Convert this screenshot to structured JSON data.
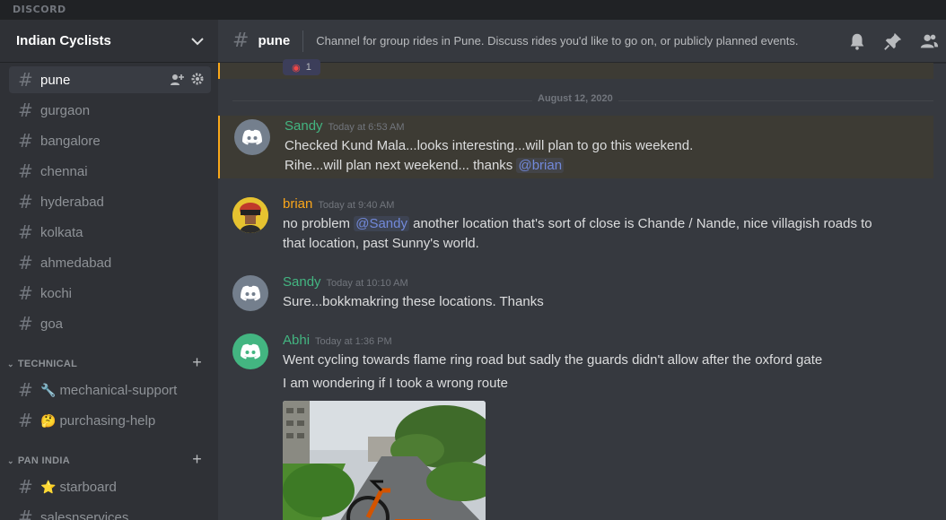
{
  "app": {
    "brand": "DISCORD"
  },
  "server": {
    "name": "Indian Cyclists"
  },
  "channels": [
    {
      "name": "pune",
      "active": true
    },
    {
      "name": "gurgaon"
    },
    {
      "name": "bangalore"
    },
    {
      "name": "chennai"
    },
    {
      "name": "hyderabad"
    },
    {
      "name": "kolkata"
    },
    {
      "name": "ahmedabad"
    },
    {
      "name": "kochi"
    },
    {
      "name": "goa"
    }
  ],
  "categories": [
    {
      "name": "TECHNICAL",
      "channels": [
        {
          "emoji": "🔧",
          "name": "mechanical-support"
        },
        {
          "emoji": "🤔",
          "name": "purchasing-help"
        }
      ]
    },
    {
      "name": "PAN INDIA",
      "channels": [
        {
          "emoji": "⭐",
          "name": "starboard"
        },
        {
          "emoji": "",
          "name": "salesnservices"
        }
      ]
    }
  ],
  "header": {
    "channel": "pune",
    "topic": "Channel for group rides in Pune. Discuss rides you'd like to go on, or publicly planned events."
  },
  "reaction": {
    "count": "1"
  },
  "date_divider": "August 12, 2020",
  "messages": [
    {
      "author": "Sandy",
      "author_color": "#43b581",
      "time": "Today at 6:53 AM",
      "lines": [
        "Checked Kund Mala...looks interesting...will plan to go this weekend.",
        "Rihe...will plan next weekend... thanks "
      ],
      "mention": "@brian"
    },
    {
      "author": "brian",
      "author_color": "#faa61a",
      "time": "Today at 9:40 AM",
      "line1_pre": "no problem ",
      "mention": "@Sandy",
      "line1_post": " another location that's sort of close is Chande / Nande, nice villagish roads to",
      "line2": "that location, past Sunny's world."
    },
    {
      "author": "Sandy",
      "author_color": "#43b581",
      "time": "Today at 10:10 AM",
      "lines": [
        "Sure...bokkmakring these locations. Thanks"
      ]
    },
    {
      "author": "Abhi",
      "author_color": "#43b581",
      "time": "Today at 1:36 PM",
      "lines": [
        "Went cycling towards flame ring road but sadly the guards didn't allow after the oxford gate",
        "I am wondering if I took a wrong route"
      ]
    }
  ]
}
